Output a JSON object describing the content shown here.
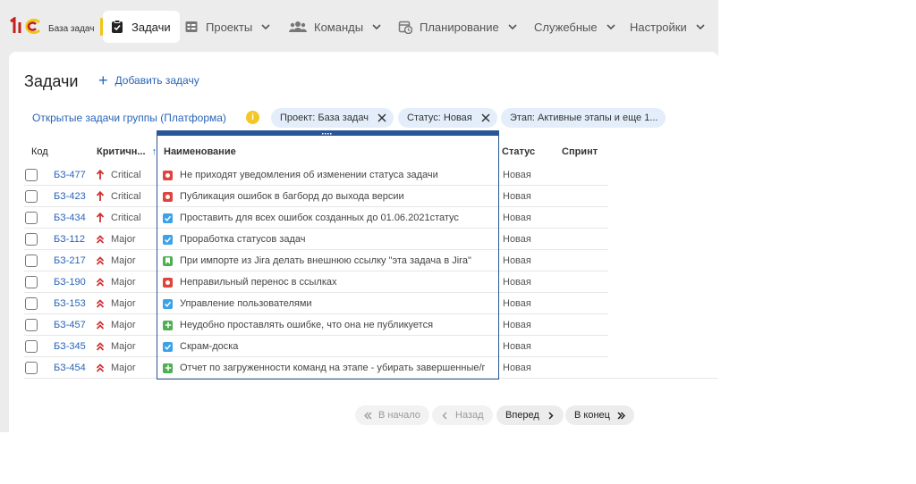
{
  "app": {
    "logo_text": "1С",
    "base_name": "База задач"
  },
  "nav": [
    {
      "label": "Задачи",
      "icon": "clipboard-check-icon",
      "active": true
    },
    {
      "label": "Проекты",
      "icon": "projects-icon"
    },
    {
      "label": "Команды",
      "icon": "team-icon"
    },
    {
      "label": "Планирование",
      "icon": "calendar-clock-icon"
    },
    {
      "label": "Служебные",
      "icon": ""
    },
    {
      "label": "Настройки",
      "icon": ""
    }
  ],
  "page": {
    "title": "Задачи",
    "add_label": "Добавить задачу"
  },
  "filters": {
    "group_link": "Открытые задачи группы (Платформа)",
    "info": "i",
    "chips": [
      "Проект: База задач",
      "Статус: Новая",
      "Этап: Активные этапы и еще 1..."
    ]
  },
  "table": {
    "headers": {
      "code": "Код",
      "criticality": "Критичн...",
      "sort_arrow": "↑",
      "name": "Наименование",
      "status": "Статус",
      "sprint": "Спринт"
    },
    "rows": [
      {
        "code": "БЗ-477",
        "criticality": "Critical",
        "type": "bug",
        "name": "Не приходят уведомления об изменении статуса задачи",
        "status": "Новая"
      },
      {
        "code": "БЗ-423",
        "criticality": "Critical",
        "type": "bug",
        "name": "Публикация ошибок в багборд до выхода версии",
        "status": "Новая"
      },
      {
        "code": "БЗ-434",
        "criticality": "Critical",
        "type": "task",
        "name": "Проставить для всех ошибок созданных до 01.06.2021статус",
        "status": "Новая"
      },
      {
        "code": "БЗ-112",
        "criticality": "Major",
        "type": "task",
        "name": "Проработка статусов задач",
        "status": "Новая"
      },
      {
        "code": "БЗ-217",
        "criticality": "Major",
        "type": "story",
        "name": "При импорте из Jira делать внешнюю ссылку \"эта задача в Jira\"",
        "status": "Новая"
      },
      {
        "code": "БЗ-190",
        "criticality": "Major",
        "type": "bug",
        "name": "Неправильный перенос в ссылках",
        "status": "Новая"
      },
      {
        "code": "БЗ-153",
        "criticality": "Major",
        "type": "task",
        "name": "Управление пользователями",
        "status": "Новая"
      },
      {
        "code": "БЗ-457",
        "criticality": "Major",
        "type": "improvement",
        "name": "Неудобно проставлять ошибке, что она не публикуется",
        "status": "Новая"
      },
      {
        "code": "БЗ-345",
        "criticality": "Major",
        "type": "task",
        "name": "Скрам-доска",
        "status": "Новая"
      },
      {
        "code": "БЗ-454",
        "criticality": "Major",
        "type": "improvement",
        "name": "Отчет по загруженности команд на этапе - убирать завершенные/пуст...",
        "status": "Новая"
      }
    ]
  },
  "pagination": {
    "first": "В начало",
    "prev": "Назад",
    "next": "Вперед",
    "last": "В конец"
  },
  "colors": {
    "accent": "#2a64b8",
    "critical": "#d03030",
    "bug": "#e0443e",
    "task": "#3aa2e8",
    "story": "#4caf50",
    "improvement": "#4caf50",
    "selected_border": "#2a5596",
    "chip_bg": "#e3eefa",
    "active_marker": "#f2c511"
  }
}
